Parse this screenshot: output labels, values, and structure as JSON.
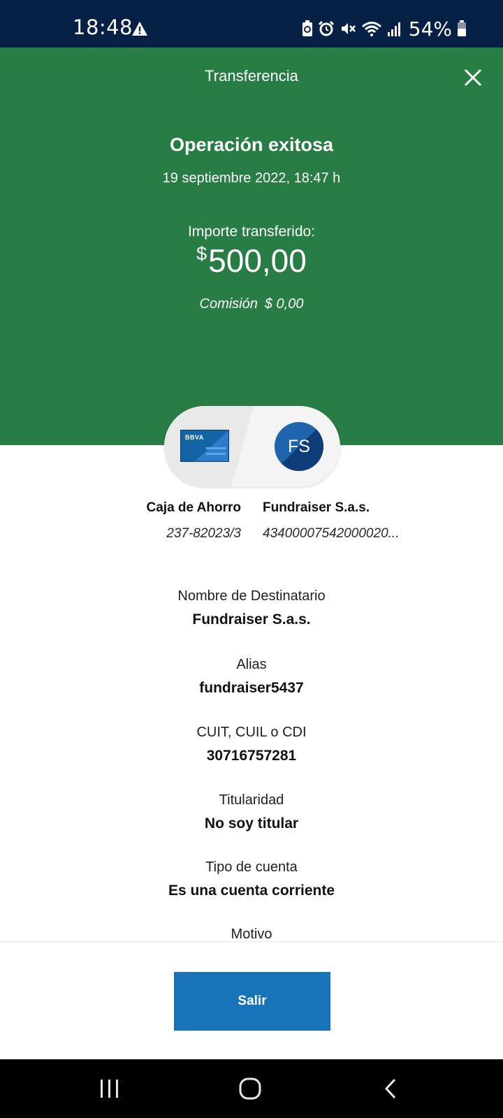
{
  "status_bar": {
    "time": "18:48",
    "battery": "54%",
    "icons": [
      "warning-icon",
      "battery-saver-icon",
      "alarm-icon",
      "mute-icon",
      "wifi-icon",
      "signal-icon",
      "battery-icon"
    ]
  },
  "header": {
    "title": "Transferencia",
    "close_icon": "close-icon"
  },
  "result": {
    "title": "Operación exitosa",
    "date": "19 septiembre 2022, 18:47 h",
    "amount_label": "Importe transferido:",
    "currency": "$",
    "amount": "500,00",
    "commission_label": "Comisión",
    "commission_value": "$ 0,00"
  },
  "accounts": {
    "from_badge": "BBVA",
    "to_initials": "FS",
    "from_name": "Caja de Ahorro",
    "from_number": "237-82023/3",
    "to_name": "Fundraiser S.a.s.",
    "to_number": "43400007542000020..."
  },
  "details": [
    {
      "label": "Nombre de Destinatario",
      "value": "Fundraiser S.a.s."
    },
    {
      "label": "Alias",
      "value": "fundraiser5437"
    },
    {
      "label": "CUIT, CUIL o CDI",
      "value": "30716757281"
    },
    {
      "label": "Titularidad",
      "value": "No soy titular"
    },
    {
      "label": "Tipo de cuenta",
      "value": "Es una cuenta corriente"
    },
    {
      "label": "Motivo",
      "value": ""
    }
  ],
  "footer": {
    "exit_label": "Salir"
  },
  "nav": {
    "icons": [
      "recent-apps-icon",
      "home-icon",
      "back-icon"
    ]
  },
  "colors": {
    "status_bar": "#072146",
    "header_green": "#277d43",
    "button_blue": "#1973b8"
  }
}
